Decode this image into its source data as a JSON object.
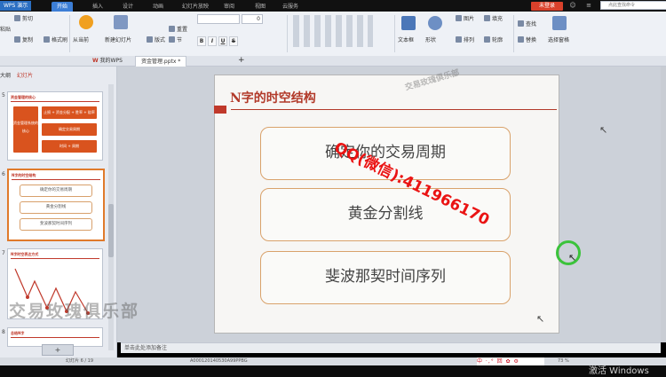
{
  "titlebar": {
    "app": "WPS 演示",
    "tabs": [
      "开始",
      "插入",
      "设计",
      "动画",
      "幻灯片放映",
      "审阅",
      "视图",
      "云服务"
    ],
    "login": "未登录"
  },
  "ribbon": {
    "paste": "粘贴",
    "cut": "剪切",
    "copy": "复制",
    "format_painter": "格式刷",
    "from_current": "从当前",
    "new_slide": "新建幻灯片",
    "layout": "版式",
    "section": "节",
    "reset": "重置",
    "font_size": "0",
    "bold": "B",
    "italic": "I",
    "underline": "U",
    "strike": "S",
    "textbox": "文本框",
    "shape": "形状",
    "image": "图片",
    "fill": "填充",
    "arrange": "排列",
    "outline": "轮廓",
    "find": "查找",
    "replace": "替换",
    "select_pane": "选择窗格"
  },
  "tabs": {
    "my_wps": "我的WPS",
    "file": "资金管理.pptx *",
    "add": "+",
    "search_placeholder": "点此查找命令"
  },
  "left_panel": {
    "tab_outline": "大纲",
    "tab_slides": "幻灯片",
    "thumb5": {
      "num": "5",
      "title": "资金管理的核心",
      "left_box": "资金管理系统的核心",
      "boxes": [
        "止损 + 资金分配 + 胜率 + 赔率",
        "确定交易周期",
        "时间 + 周期"
      ]
    },
    "thumb6": {
      "num": "6",
      "title": "N字的时空结构",
      "items": [
        "确定你的交易周期",
        "黄金分割线",
        "斐波那契时间序列"
      ]
    },
    "thumb7": {
      "num": "7",
      "title": "N字时空表达方式"
    },
    "thumb8": {
      "num": "8",
      "title": "总结N字"
    },
    "add_slide": "+"
  },
  "slide": {
    "title": "N字的时空结构",
    "items": [
      "确定你的交易周期",
      "黄金分割线",
      "斐波那契时间序列"
    ],
    "overlay": "QQ(微信):411966170",
    "watermark": "交易玫瑰俱乐部"
  },
  "watermark_big": "交易玫瑰俱乐部",
  "notes": {
    "placeholder": "单击此处添加备注"
  },
  "status": {
    "slide_info": "幻灯片 6 / 19",
    "theme": "A000120140530A99PPBG",
    "zoom": "73 %"
  },
  "ime": "中 ·,° 回 ✿ ⚙",
  "activate": "激活 Windows"
}
